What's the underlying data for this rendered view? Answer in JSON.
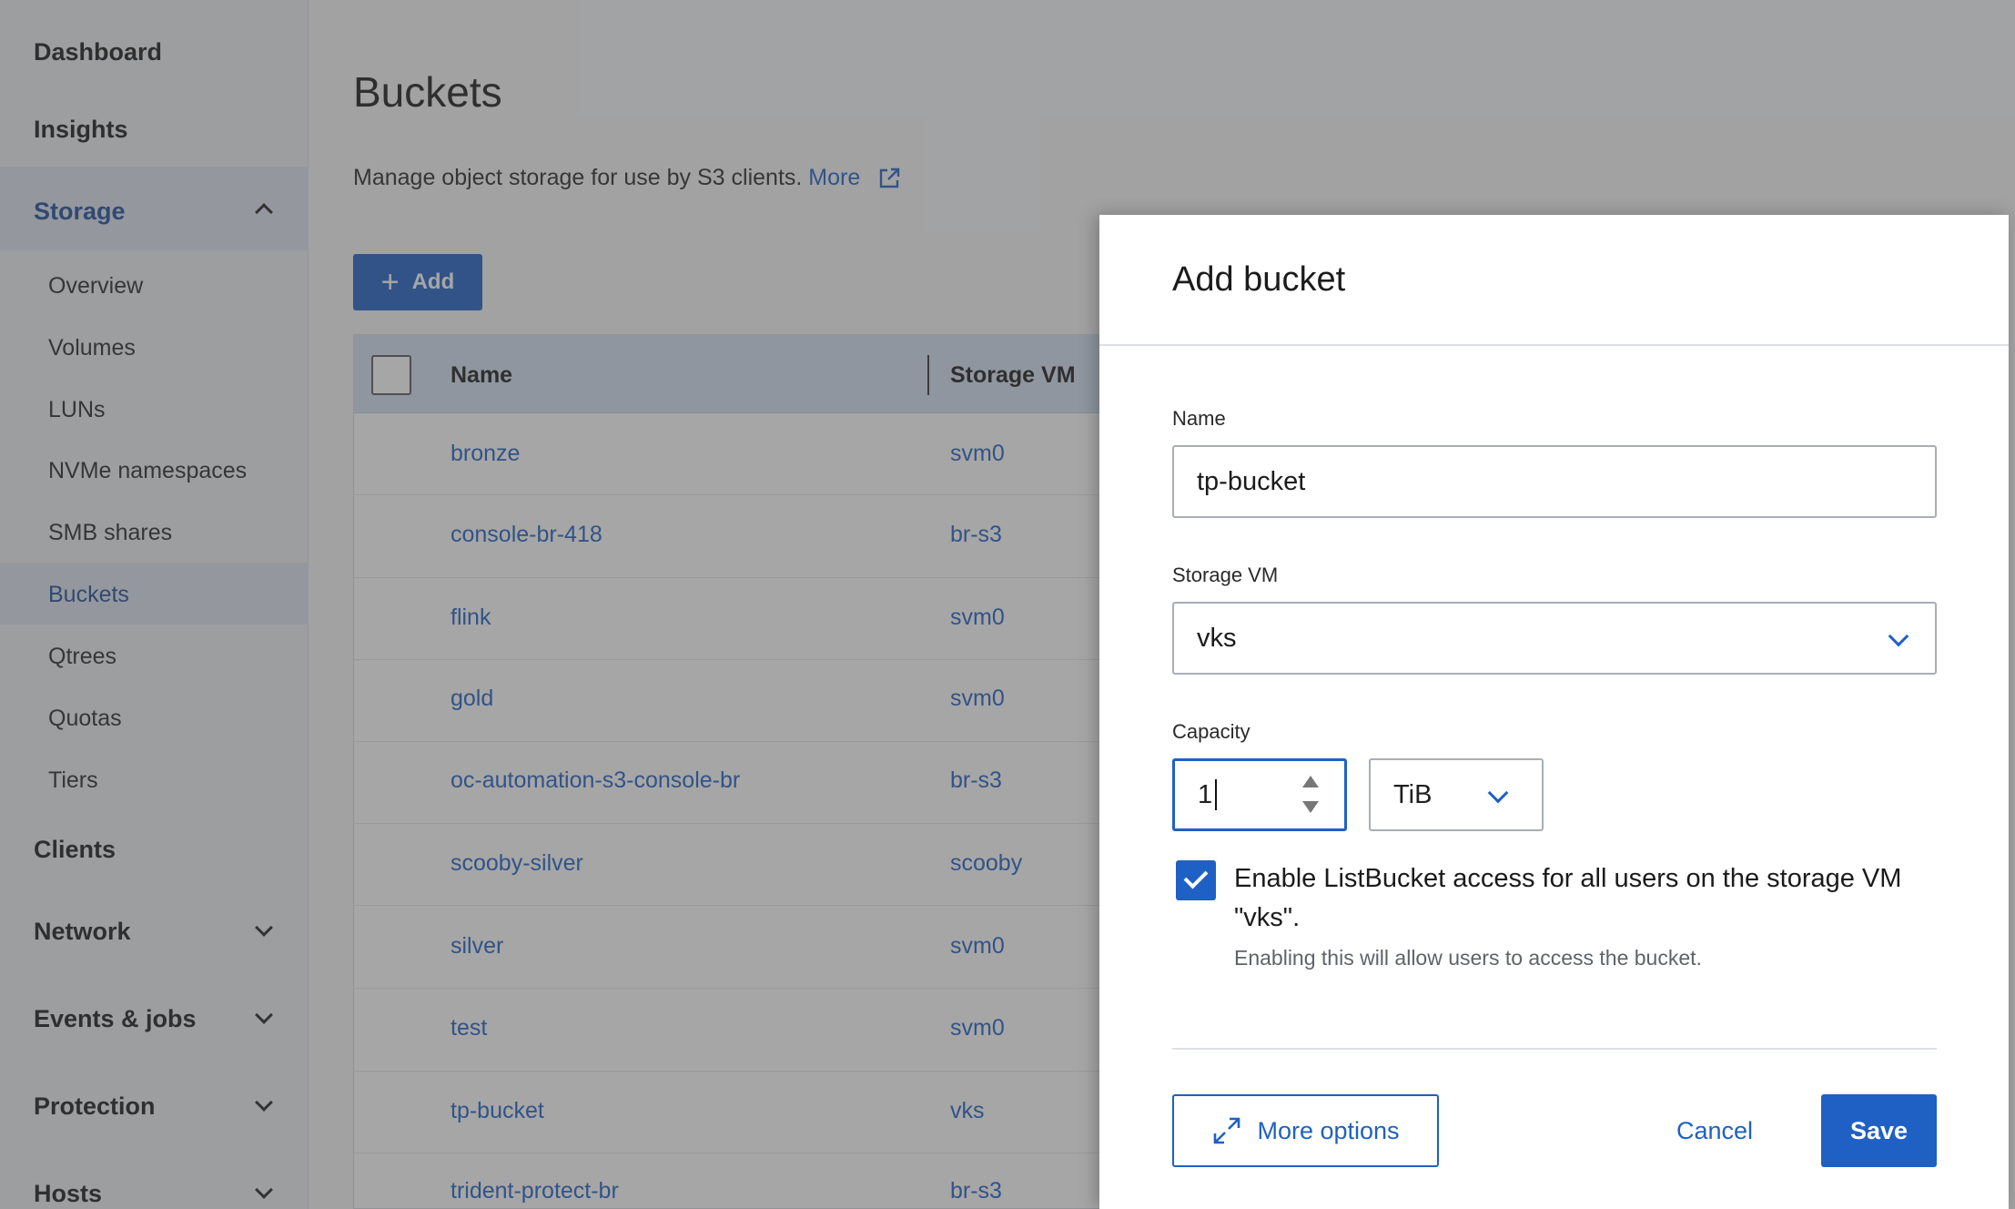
{
  "sidebar": {
    "dashboard": "Dashboard",
    "insights": "Insights",
    "storage": "Storage",
    "storage_items": [
      "Overview",
      "Volumes",
      "LUNs",
      "NVMe namespaces",
      "SMB shares",
      "Buckets",
      "Qtrees",
      "Quotas",
      "Tiers"
    ],
    "active_item": "Buckets",
    "clients": "Clients",
    "network": "Network",
    "events_jobs": "Events & jobs",
    "protection": "Protection",
    "hosts": "Hosts"
  },
  "main": {
    "title": "Buckets",
    "description": "Manage object storage for use by S3 clients.",
    "more_link": "More",
    "add_button": "Add",
    "table": {
      "columns": [
        "Name",
        "Storage VM"
      ],
      "rows": [
        {
          "name": "bronze",
          "vm": "svm0"
        },
        {
          "name": "console-br-418",
          "vm": "br-s3"
        },
        {
          "name": "flink",
          "vm": "svm0"
        },
        {
          "name": "gold",
          "vm": "svm0"
        },
        {
          "name": "oc-automation-s3-console-br",
          "vm": "br-s3"
        },
        {
          "name": "scooby-silver",
          "vm": "scooby"
        },
        {
          "name": "silver",
          "vm": "svm0"
        },
        {
          "name": "test",
          "vm": "svm0"
        },
        {
          "name": "tp-bucket",
          "vm": "vks"
        },
        {
          "name": "trident-protect-br",
          "vm": "br-s3"
        }
      ]
    }
  },
  "dialog": {
    "title": "Add bucket",
    "name_label": "Name",
    "name_value": "tp-bucket",
    "vm_label": "Storage VM",
    "vm_value": "vks",
    "capacity_label": "Capacity",
    "capacity_value": "1",
    "capacity_unit": "TiB",
    "listbucket_checked": true,
    "listbucket_label": "Enable ListBucket access for all users on the storage VM \"vks\".",
    "listbucket_help": "Enabling this will allow users to access the bucket.",
    "more_options": "More options",
    "cancel": "Cancel",
    "save": "Save"
  },
  "colors": {
    "accent": "#1f60c4",
    "header_bg": "#d3e0f1"
  }
}
